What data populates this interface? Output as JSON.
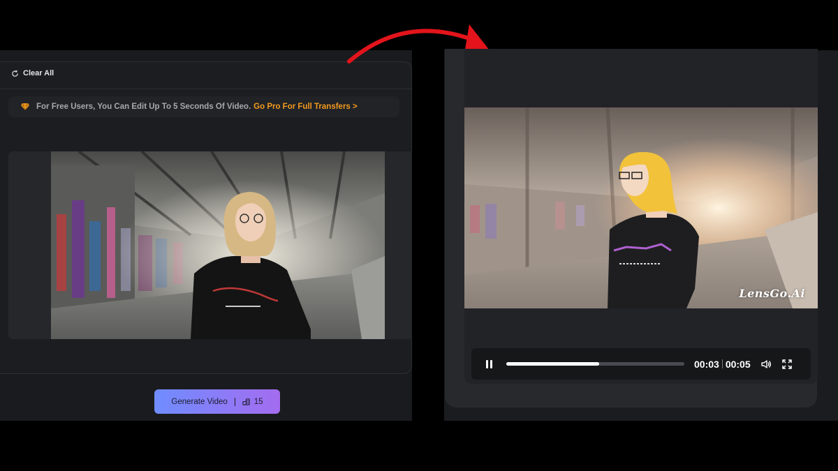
{
  "left": {
    "clear_all_label": "Clear All",
    "notice_text": "For Free Users, You Can Edit Up To 5 Seconds Of Video.",
    "notice_link": "Go Pro For Full Transfers >",
    "generate_label": "Generate Video",
    "credit_cost": "15"
  },
  "right": {
    "watermark": "LensGo.Ai",
    "player": {
      "current_time": "00:03",
      "total_time": "00:05",
      "progress": 0.52
    }
  },
  "colors": {
    "accent_orange": "#f39a1e",
    "button_gradient_start": "#6f8dff",
    "button_gradient_end": "#a46cf0",
    "arrow_red": "#e3141b"
  },
  "icons": [
    "refresh-icon",
    "diamond-icon",
    "coins-icon",
    "pause-icon",
    "volume-icon",
    "fullscreen-icon",
    "curved-arrow-icon"
  ]
}
